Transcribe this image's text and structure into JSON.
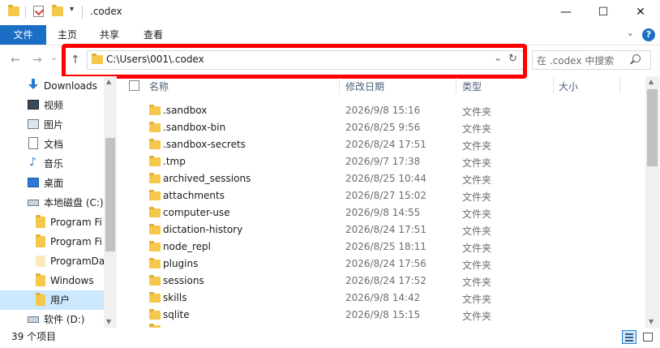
{
  "window": {
    "title": ".codex",
    "minimize": "—",
    "maximize": "☐",
    "close": "✕"
  },
  "ribbon": {
    "tabs": [
      "文件",
      "主页",
      "共享",
      "查看"
    ],
    "collapse": "⌄",
    "help": "?"
  },
  "nav": {
    "back": "←",
    "forward": "→",
    "recent": "⌄",
    "up": "↑",
    "address": "C:\\Users\\001\\.codex",
    "address_dropdown": "⌄",
    "refresh": "↻",
    "search_placeholder": "在 .codex 中搜索",
    "search_icon": "search-icon"
  },
  "sidebar": {
    "items": [
      {
        "label": "Downloads",
        "icon": "download-arrow-icon"
      },
      {
        "label": "视频",
        "icon": "video-icon"
      },
      {
        "label": "图片",
        "icon": "pictures-icon"
      },
      {
        "label": "文档",
        "icon": "documents-icon"
      },
      {
        "label": "音乐",
        "icon": "music-icon"
      },
      {
        "label": "桌面",
        "icon": "desktop-icon"
      },
      {
        "label": "本地磁盘 (C:)",
        "icon": "drive-icon"
      },
      {
        "label": "Program Fi",
        "icon": "folder-icon"
      },
      {
        "label": "Program Fi",
        "icon": "folder-icon"
      },
      {
        "label": "ProgramDa",
        "icon": "folder-icon"
      },
      {
        "label": "Windows",
        "icon": "folder-icon"
      },
      {
        "label": "用户",
        "icon": "folder-icon",
        "selected": true
      },
      {
        "label": "软件 (D:)",
        "icon": "drive-icon"
      }
    ]
  },
  "columns": {
    "name": "名称",
    "date": "修改日期",
    "type": "类型",
    "size": "大小"
  },
  "rows": [
    {
      "name": ".sandbox",
      "date": "2026/9/8 15:16",
      "type": "文件夹"
    },
    {
      "name": ".sandbox-bin",
      "date": "2026/8/25 9:56",
      "type": "文件夹"
    },
    {
      "name": ".sandbox-secrets",
      "date": "2026/8/24 17:51",
      "type": "文件夹"
    },
    {
      "name": ".tmp",
      "date": "2026/9/7 17:38",
      "type": "文件夹"
    },
    {
      "name": "archived_sessions",
      "date": "2026/8/25 10:44",
      "type": "文件夹"
    },
    {
      "name": "attachments",
      "date": "2026/8/27 15:02",
      "type": "文件夹"
    },
    {
      "name": "computer-use",
      "date": "2026/9/8 14:55",
      "type": "文件夹"
    },
    {
      "name": "dictation-history",
      "date": "2026/8/24 17:51",
      "type": "文件夹"
    },
    {
      "name": "node_repl",
      "date": "2026/8/25 18:11",
      "type": "文件夹"
    },
    {
      "name": "plugins",
      "date": "2026/8/24 17:56",
      "type": "文件夹"
    },
    {
      "name": "sessions",
      "date": "2026/8/24 17:52",
      "type": "文件夹"
    },
    {
      "name": "skills",
      "date": "2026/9/8 14:42",
      "type": "文件夹"
    },
    {
      "name": "sqlite",
      "date": "2026/9/8 15:15",
      "type": "文件夹"
    }
  ],
  "status": {
    "item_count": "39 个项目"
  },
  "colors": {
    "accent": "#1a6fc4",
    "selection": "#cce8ff",
    "highlight_box": "#ff0000",
    "folder": "#f5c84c"
  }
}
